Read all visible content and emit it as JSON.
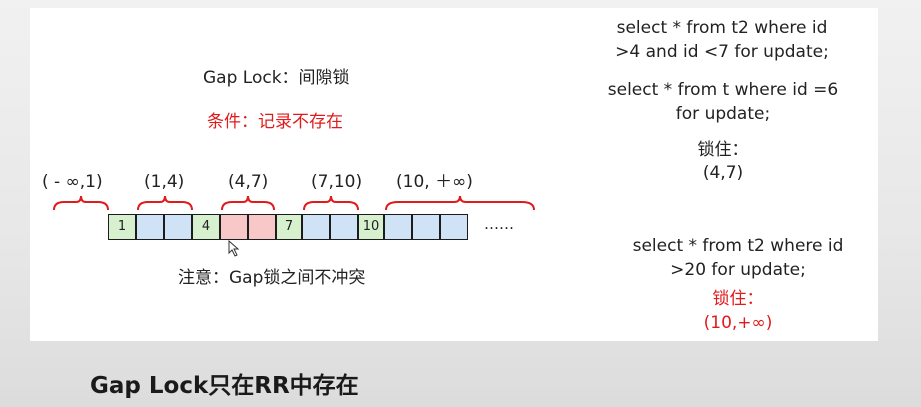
{
  "title": "Gap Lock：间隙锁",
  "condition": "条件：记录不存在",
  "ranges": [
    "( - ∞,1)",
    "(1,4)",
    "(4,7)",
    "(7,10)",
    "(10, ＋∞)"
  ],
  "cells": [
    "1",
    "",
    "",
    "4",
    "",
    "",
    "7",
    "",
    "",
    "10",
    "",
    "",
    "",
    ""
  ],
  "ellipsis": "……",
  "note": "注意：Gap锁之间不冲突",
  "sql1": {
    "line1": "select * from t2 where id",
    "line2": ">4 and id <7 for update;"
  },
  "sql2": {
    "line1": "select * from t where id =6",
    "line2": "for update;"
  },
  "lock1": {
    "label": "锁住：",
    "value": "(4,7)"
  },
  "sql3": {
    "line1": "select * from t2 where id",
    "line2": ">20 for update;"
  },
  "lock2": {
    "label": "锁住：",
    "value": "(10,+∞)"
  },
  "footer": "Gap Lock只在RR中存在",
  "colors": {
    "red": "#e01b1b",
    "brace": "#e01b1b",
    "green": "#d7f1cf",
    "blue": "#cfe2f6",
    "pink": "#f8c7c7"
  }
}
